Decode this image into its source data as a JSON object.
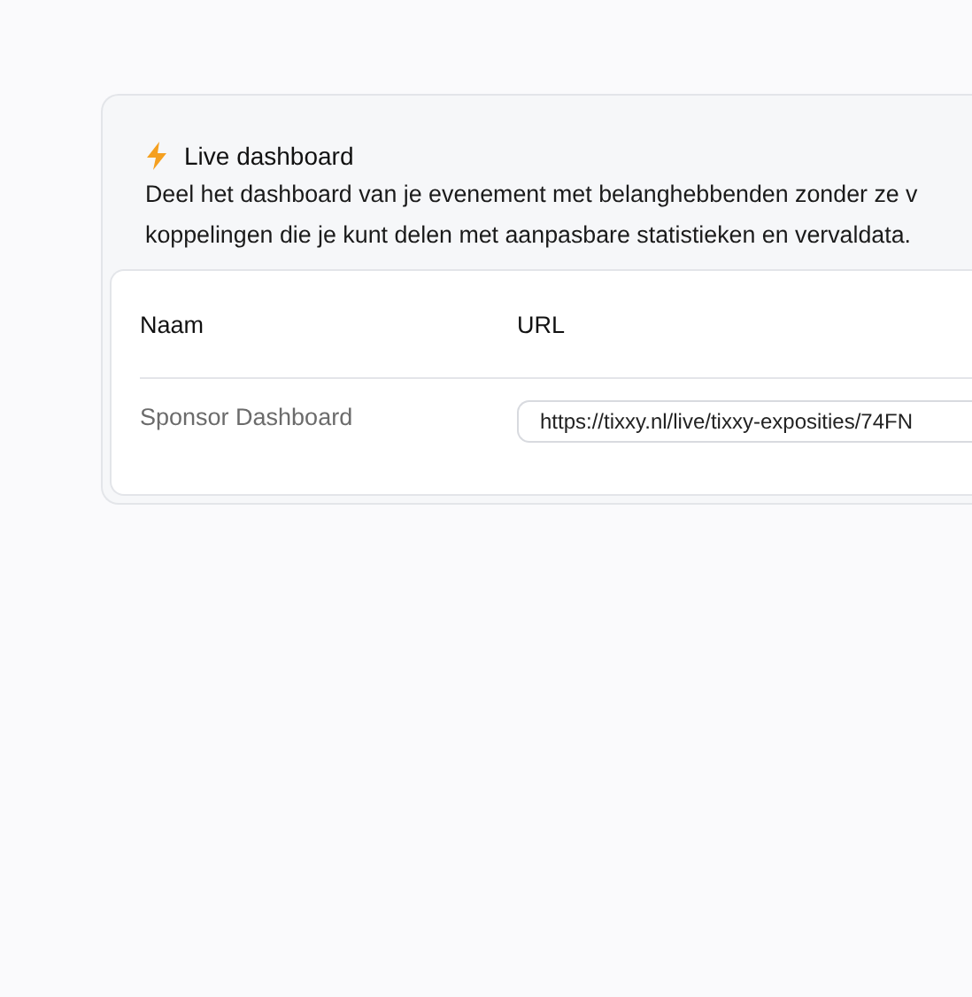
{
  "card": {
    "title": "Live dashboard",
    "description_lines": [
      "Deel het dashboard van je evenement met belanghebbenden zonder ze v",
      "koppelingen die je kunt delen met aanpasbare statistieken en vervaldata."
    ]
  },
  "table": {
    "columns": [
      "Naam",
      "URL"
    ],
    "rows": [
      {
        "name": "Sponsor Dashboard",
        "url": "https://tixxy.nl/live/tixxy-exposities/74FN"
      }
    ]
  }
}
